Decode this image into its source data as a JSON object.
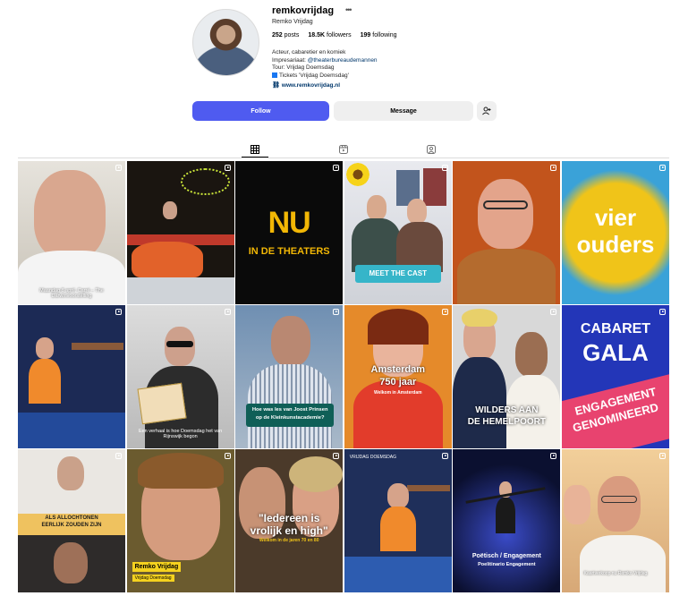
{
  "profile": {
    "username": "remkovrijdag",
    "full_name": "Remko Vrijdag",
    "posts": "252",
    "posts_label": "posts",
    "followers": "18.5K",
    "followers_label": "followers",
    "following": "199",
    "following_label": "following",
    "bio_line1": "Acteur, cabaretier en komiek",
    "bio_line2_prefix": "Impresariaat: ",
    "bio_line2_tag": "@theaterbureaudemannen",
    "bio_line3": "Tour: Vrijdag Doemsdag",
    "bio_line4": "Tickets 'Vrijdag Doemsdag'",
    "website": "www.remkovrijdag.nl"
  },
  "buttons": {
    "follow": "Follow",
    "message": "Message"
  },
  "tabs": [
    "grid-icon",
    "reels-icon",
    "tagged-icon"
  ],
  "posts": [
    {
      "caption": "Maandag 8 april, Carré – The Darwinvoorstelling"
    },
    {
      "caption": ""
    },
    {
      "text_line1": "NU",
      "text_line2": "IN DE THEATERS"
    },
    {
      "caption": "MEET THE CAST"
    },
    {
      "caption": ""
    },
    {
      "text_line1": "vier",
      "text_line2": "ouders"
    },
    {
      "caption": ""
    },
    {
      "caption": "Een verhaal is hoe Doemsdag het van Rijnswijk begon"
    },
    {
      "caption": "Hoe was les van Joost Prinsen op de Kleinkunstacademie?"
    },
    {
      "text_line1": "Amsterdam",
      "text_line2": "750 jaar",
      "text_line3": "Welkom in Amsterdam"
    },
    {
      "text_line1": "WILDERS AAN",
      "text_line2": "DE HEMELPOORT"
    },
    {
      "text_line1": "CABARET",
      "text_line2": "GALA",
      "text_line3": "ENGAGEMENT",
      "text_line4": "GENOMINEERD"
    },
    {
      "text_line1": "ALS ALLOCHTONEN",
      "text_line2": "EERLIJK ZOUDEN ZIJN"
    },
    {
      "text_line1": "Remko Vrijdag",
      "text_line2": "Vrijdag Doemsdag"
    },
    {
      "text_line1": "\"Iedereen is",
      "text_line2": "vrolijk en high\"",
      "text_line3": "Welkom in de jaren 70 en 80"
    },
    {
      "caption": "VRIJDAG DOEMSDAG"
    },
    {
      "text_line1": "Poëtisch / Engagement",
      "text_line2": "Poelitinario Engagement"
    },
    {
      "caption": "Kaartverkoop nu Remko Vrijdag"
    }
  ],
  "colors": {
    "follow_blue": "#4f5bf0",
    "link_blue": "#00376b",
    "button_gray": "#efefef"
  }
}
